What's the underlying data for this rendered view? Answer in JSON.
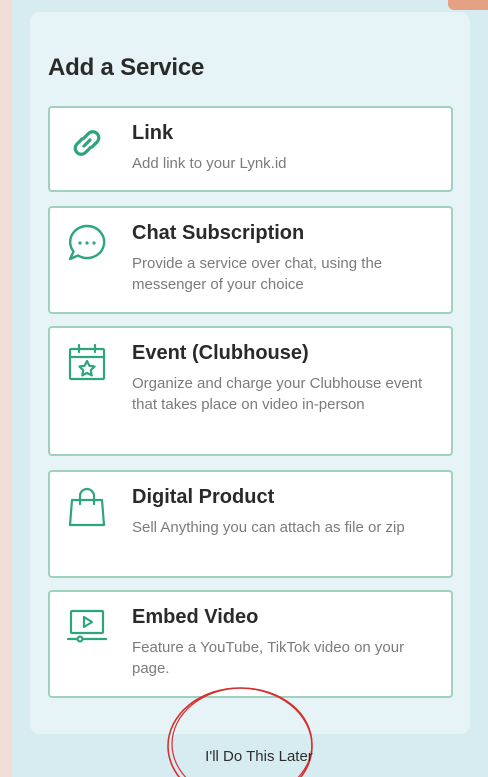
{
  "card": {
    "title": "Add a Service"
  },
  "services": [
    {
      "name": "Link",
      "description": "Add link to your Lynk.id",
      "icon": "link-icon"
    },
    {
      "name": "Chat Subscription",
      "description": "Provide a service over chat, using the messenger of your choice",
      "icon": "chat-bubble-icon"
    },
    {
      "name": "Event (Clubhouse)",
      "description": "Organize and charge your Clubhouse event that takes place on video in-person",
      "icon": "calendar-star-icon"
    },
    {
      "name": "Digital Product",
      "description": "Sell Anything you can attach as file or zip",
      "icon": "shopping-bag-icon"
    },
    {
      "name": "Embed Video",
      "description": "Feature a YouTube, TikTok video on your page.",
      "icon": "video-play-icon"
    }
  ],
  "footer": {
    "later_label": "I'll Do This Later"
  },
  "colors": {
    "accent": "#2fa57c",
    "border": "#9fd1bd",
    "annotation": "#d3312f"
  }
}
